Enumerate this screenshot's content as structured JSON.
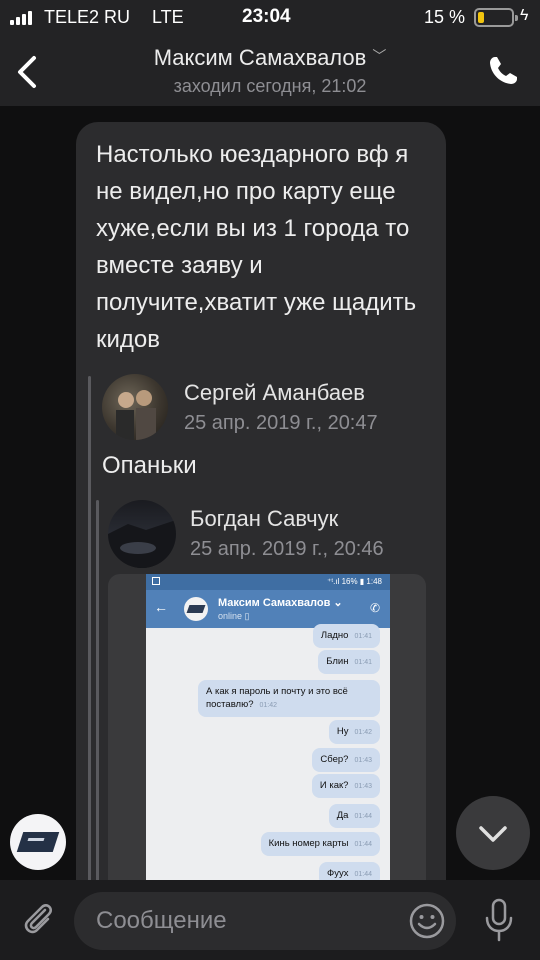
{
  "status_bar": {
    "carrier": "TELE2 RU",
    "network": "LTE",
    "time": "23:04",
    "battery_percent": "15 %"
  },
  "header": {
    "title": "Максим Самахвалов",
    "subtitle": "заходил сегодня, 21:02",
    "back_icon": "chevron-left-icon",
    "call_icon": "phone-icon"
  },
  "message": {
    "text": "Настолько юездарного вф я не видел,но про карту еще хуже,если вы из 1 города то вместе заяву и получите,хватит уже щадить кидов",
    "forwarded": {
      "author": "Сергей Аманбаев",
      "date": "25 апр. 2019 г., 20:47",
      "text": "Опаньки",
      "forwarded": {
        "author": "Богдан Савчук",
        "date": "25 апр. 2019 г., 20:46",
        "photo": {
          "status": "⁺ᵗ.ıl 16% ▮ 1:48",
          "chat_name": "Максим Самахвалов ⌄",
          "chat_status": "online ▯",
          "messages": [
            {
              "text": "Ладно",
              "time": "01:41"
            },
            {
              "text": "Блин",
              "time": "01:41"
            },
            {
              "text": "А как я пароль и почту и это всё поставлю?",
              "time": "01:42"
            },
            {
              "text": "Ну",
              "time": "01:42"
            },
            {
              "text": "Сбер?",
              "time": "01:43"
            },
            {
              "text": "И как?",
              "time": "01:43"
            },
            {
              "text": "Да",
              "time": "01:44"
            },
            {
              "text": "Кинь номер карты",
              "time": "01:44"
            },
            {
              "text": "Фуух",
              "time": "01:44"
            }
          ]
        }
      }
    }
  },
  "composer": {
    "placeholder": "Сообщение",
    "attach_icon": "paperclip-icon",
    "emoji_icon": "smiley-icon",
    "mic_icon": "microphone-icon"
  },
  "colors": {
    "background": "#0f0f10",
    "bar": "#232325",
    "bubble": "#2c2c2e",
    "secondary_text": "#8e8e93",
    "battery_low": "#f1c40f"
  }
}
